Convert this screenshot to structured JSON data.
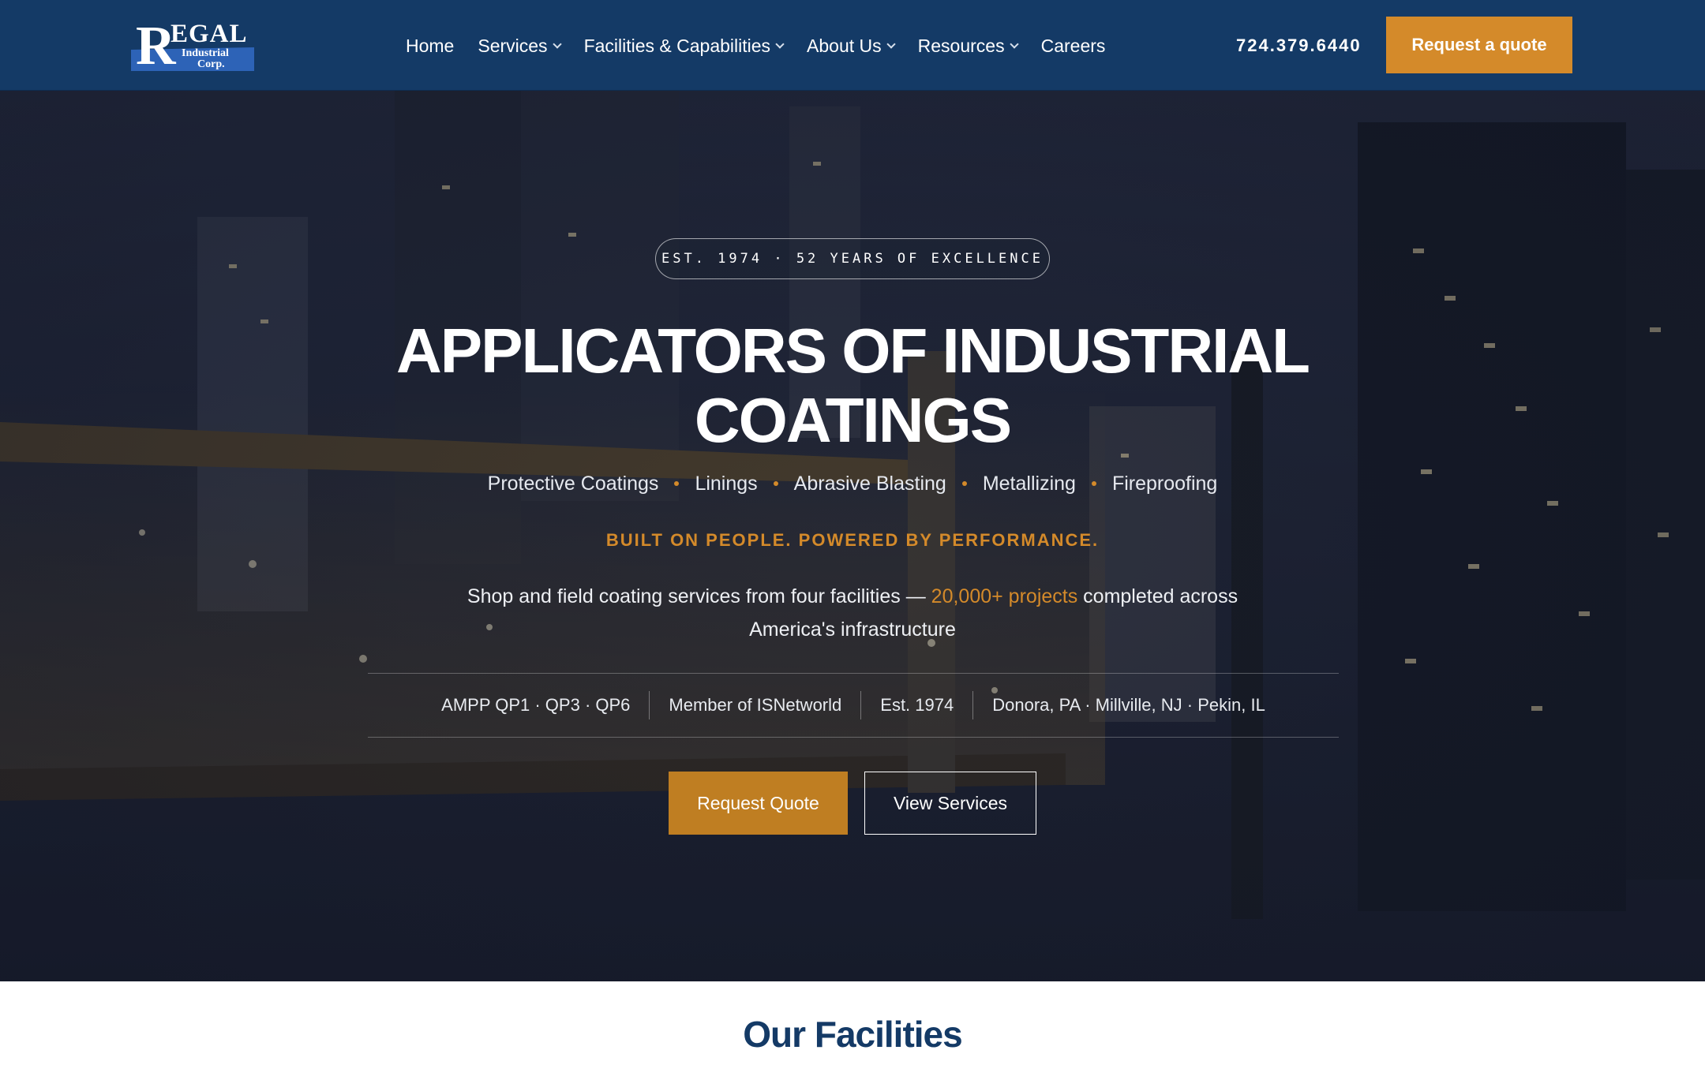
{
  "brand": {
    "logo_initial": "R",
    "logo_rest": "EGAL",
    "logo_line1": "Industrial",
    "logo_line2": "Corp.",
    "navy": "#143a66",
    "accent": "#d48a2a"
  },
  "nav": {
    "items": [
      {
        "label": "Home",
        "has_dropdown": false
      },
      {
        "label": "Services",
        "has_dropdown": true
      },
      {
        "label": "Facilities & Capabilities",
        "has_dropdown": true
      },
      {
        "label": "About Us",
        "has_dropdown": true
      },
      {
        "label": "Resources",
        "has_dropdown": true
      },
      {
        "label": "Careers",
        "has_dropdown": false
      }
    ],
    "phone": "724.379.6440",
    "quote_button": "Request a quote"
  },
  "hero": {
    "badge": "EST. 1974 · 52 YEARS OF EXCELLENCE",
    "title_line1": "APPLICATORS OF INDUSTRIAL",
    "title_line2": "COATINGS",
    "services": [
      "Protective Coatings",
      "Linings",
      "Abrasive Blasting",
      "Metallizing",
      "Fireproofing"
    ],
    "tagline": "BUILT ON PEOPLE. POWERED BY PERFORMANCE.",
    "description_before": "Shop and field coating services from four facilities — ",
    "description_highlight": "20,000+ projects",
    "description_after": " completed across America's infrastructure",
    "facts": [
      "AMPP QP1 · QP3 · QP6",
      "Member of ISNetworld",
      "Est. 1974",
      "Donora, PA · Millville, NJ · Pekin, IL"
    ],
    "primary_button": "Request Quote",
    "secondary_button": "View Services"
  },
  "facilities": {
    "title": "Our Facilities"
  }
}
